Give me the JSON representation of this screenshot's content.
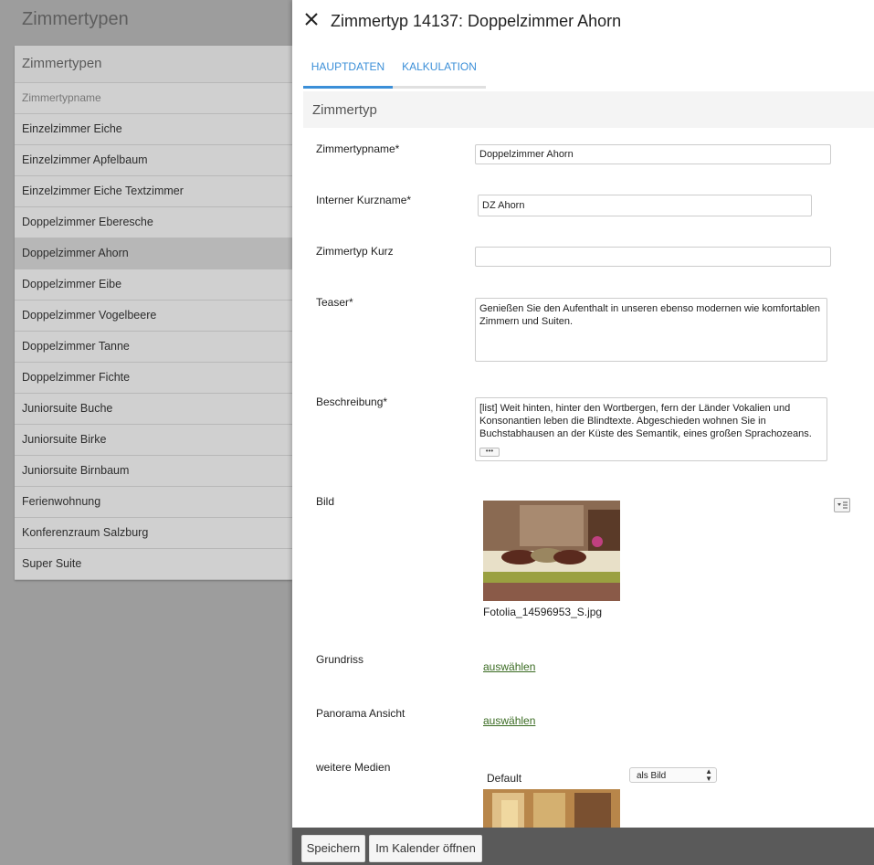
{
  "left": {
    "title": "Zimmertypen",
    "card_title": "Zimmertypen",
    "column_header": "Zimmertypname",
    "items": [
      "Einzelzimmer Eiche",
      "Einzelzimmer Apfelbaum",
      "Einzelzimmer Eiche Textzimmer",
      "Doppelzimmer Eberesche",
      "Doppelzimmer Ahorn",
      "Doppelzimmer Eibe",
      "Doppelzimmer Vogelbeere",
      "Doppelzimmer Tanne",
      "Doppelzimmer Fichte",
      "Juniorsuite Buche",
      "Juniorsuite Birke",
      "Juniorsuite Birnbaum",
      "Ferienwohnung",
      "Konferenzraum Salzburg",
      "Super Suite"
    ],
    "selected_item": "Doppelzimmer Ahorn"
  },
  "panel": {
    "title": "Zimmertyp 14137: Doppelzimmer Ahorn",
    "tabs": [
      "HAUPTDATEN",
      "KALKULATION"
    ],
    "active_tab": "HAUPTDATEN",
    "section_title": "Zimmertyp"
  },
  "form": {
    "zimmertypname_label": "Zimmertypname*",
    "zimmertypname_value": "Doppelzimmer Ahorn",
    "kurzname_label": "Interner Kurzname*",
    "kurzname_value": "DZ Ahorn",
    "zimmertyp_kurz_label": "Zimmertyp Kurz",
    "zimmertyp_kurz_value": "",
    "teaser_label": "Teaser*",
    "teaser_value": "Genießen Sie den Aufenthalt in unseren ebenso modernen wie komfortablen Zimmern und Suiten.",
    "beschreibung_label": "Beschreibung*",
    "beschreibung_value": "[list] Weit hinten, hinter den Wortbergen, fern der Länder Vokalien und Konsonantien leben die Blindtexte. Abgeschieden wohnen Sie in Buchstabhausen an der Küste des Semantik, eines großen Sprachozeans. Ein kleines Bächlein namens Duden fließt durch ihren Ort und versorgt sie mit den",
    "more_label": "•••",
    "bild_label": "Bild",
    "bild_filename": "Fotolia_14596953_S.jpg",
    "grundriss_label": "Grundriss",
    "grundriss_link": "auswählen",
    "panorama_label": "Panorama Ansicht",
    "panorama_link": "auswählen",
    "medien_label": "weitere Medien",
    "medien_default": "Default",
    "medien_select": "als Bild"
  },
  "footer": {
    "save_label": "Speichern",
    "calendar_label": "Im Kalender öffnen"
  }
}
